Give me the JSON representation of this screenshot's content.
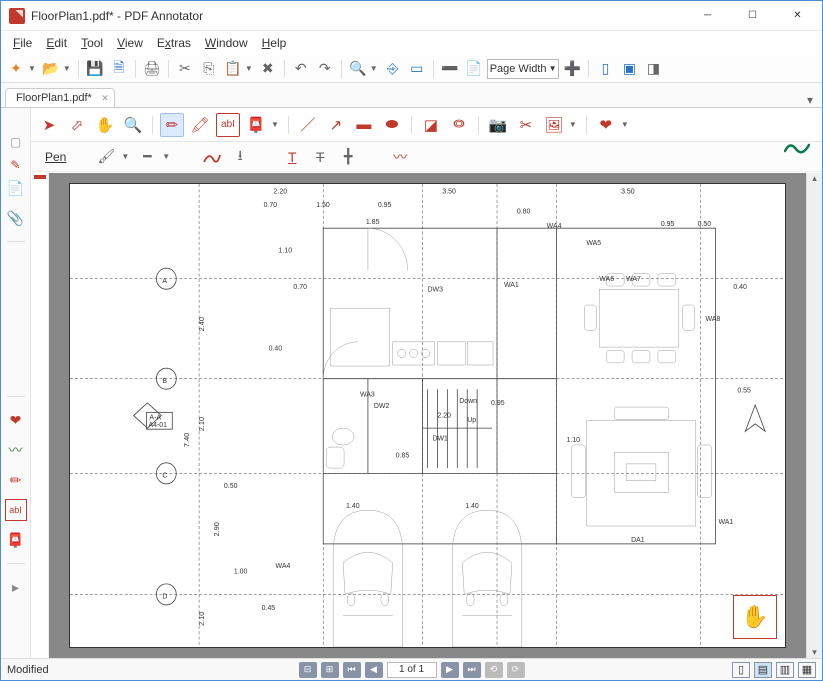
{
  "window": {
    "title": "FloorPlan1.pdf* - PDF Annotator"
  },
  "menu": {
    "file": "File",
    "edit": "Edit",
    "tool": "Tool",
    "view": "View",
    "extras": "Extras",
    "window": "Window",
    "help": "Help"
  },
  "main_toolbar": {
    "zoom_mode": "Page Width"
  },
  "doc_tab": {
    "name": "FloorPlan1.pdf*"
  },
  "anno_toolbar2": {
    "tool_label": "Pen"
  },
  "statusbar": {
    "status": "Modified",
    "page_display": "1 of 1"
  },
  "floorplan": {
    "grid_rows": [
      "A",
      "B",
      "C",
      "D"
    ],
    "dimensions_top": [
      "2.20",
      "3.50",
      "3.50"
    ],
    "dimensions_top2": [
      "0.70",
      "1.50",
      "0.95"
    ],
    "dimensions_top3": [
      "0.80"
    ],
    "dimensions_top4": [
      "0.95",
      "0.50"
    ],
    "dim_185": "1.85",
    "dim_110": "1.10",
    "dim_070": "0.70",
    "dim_240": "2.40",
    "dim_040": "0.40",
    "dim_740": "7.40",
    "dim_210L": "2.10",
    "dim_050": "0.50",
    "dim_290": "2.90",
    "dim_100": "1.00",
    "dim_210B": "2.10",
    "dim_045": "0.45",
    "dim_110R": "1.10",
    "dim_055": "0.55",
    "dim_040R": "0.40",
    "dim_085": "0.85",
    "dim_095": "0.95",
    "dim_140a": "1.40",
    "dim_140b": "1.40",
    "dim_220b": "2.20",
    "txt_down": "Down",
    "txt_up": "Up",
    "section_label": "A-A",
    "section_ref": "A4-01",
    "rooms": {
      "wa3": "WA3",
      "wa4": "WA4",
      "wa5": "WA5",
      "wa6": "WA6",
      "wa7": "WA7",
      "wa8": "WA8",
      "wa1": "WA1",
      "wa1b": "WA1",
      "dw1": "DW1",
      "dw2": "DW2",
      "dw3": "DW3",
      "da1": "DA1"
    }
  }
}
